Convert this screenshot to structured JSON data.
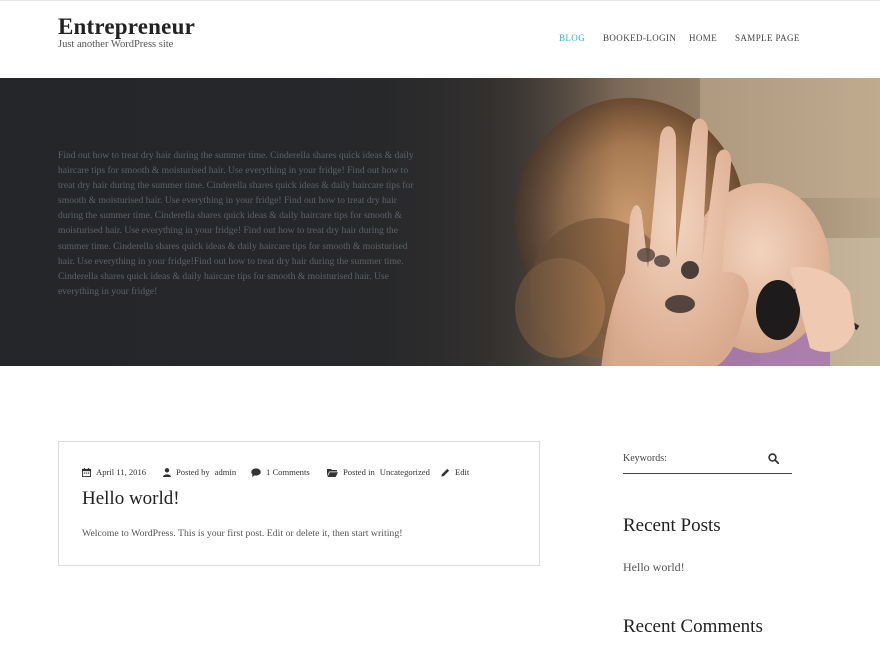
{
  "site": {
    "title": "Entrepreneur",
    "tagline": "Just another WordPress site"
  },
  "nav": {
    "items": [
      {
        "label": "BLOG",
        "active": true
      },
      {
        "label": "BOOKED-LOGIN",
        "active": false
      },
      {
        "label": "HOME",
        "active": false
      },
      {
        "label": "SAMPLE PAGE",
        "active": false
      }
    ]
  },
  "hero": {
    "text": "Find out how to treat dry hair during the summer time. Cinderella shares quick ideas & daily haircare tips for smooth & moisturised hair. Use everything in your fridge! Find out how to treat dry hair during the summer time. Cinderella shares quick ideas & daily haircare tips for smooth & moisturised hair. Use everything in your fridge! Find out how to treat dry hair during the summer time. Cinderella shares quick ideas & daily haircare tips for smooth & moisturised hair. Use everything in your fridge! Find out how to treat dry hair during the summer time. Cinderella shares quick ideas & daily haircare tips for smooth & moisturised hair. Use everything in your fridge!Find out how to treat dry hair during the summer time. Cinderella shares quick ideas & daily haircare tips for smooth & moisturised hair. Use everything in your fridge!"
  },
  "post": {
    "date": "April 11, 2016",
    "author_prefix": "Posted by",
    "author": "admin",
    "comments": "1 Comments",
    "category_prefix": "Posted in",
    "category": "Uncategorized",
    "edit": "Edit",
    "title": "Hello world!",
    "excerpt": "Welcome to WordPress. This is your first post. Edit or delete it, then start writing!"
  },
  "sidebar": {
    "search_placeholder": "Keywords:",
    "recent_posts_title": "Recent Posts",
    "recent_posts": [
      "Hello world!"
    ],
    "recent_comments_title": "Recent Comments"
  },
  "colors": {
    "accent": "#2bb7c4",
    "hero_dark": "#242629",
    "text": "#333333",
    "border": "#dcdcdc"
  },
  "icons": [
    "calendar-icon",
    "user-icon",
    "comment-icon",
    "folder-icon",
    "pencil-icon",
    "search-icon"
  ]
}
